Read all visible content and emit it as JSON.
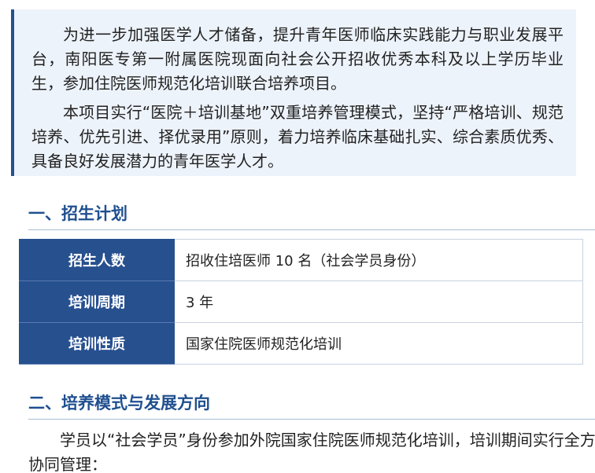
{
  "intro": {
    "paragraphs": [
      "为进一步加强医学人才储备，提升青年医师临床实践能力与职业发展平台，南阳医专第一附属医院现面向社会公开招收优秀本科及以上学历毕业生，参加住院医师规范化培训联合培养项目。",
      "本项目实行“医院＋培训基地”双重培养管理模式，坚持“严格培训、规范培养、优先引进、择优录用”原则，着力培养临床基础扎实、综合素质优秀、具备良好发展潜力的青年医学人才。"
    ]
  },
  "sections": [
    {
      "title": "一、招生计划"
    },
    {
      "title": "二、培养模式与发展方向"
    }
  ],
  "plan_table": {
    "rows": [
      {
        "label": "招生人数",
        "value": "招收住培医师 10 名（社会学员身份）"
      },
      {
        "label": "培训周期",
        "value": "3 年"
      },
      {
        "label": "培训性质",
        "value": "国家住院医师规范化培训"
      }
    ]
  },
  "section2": {
    "paragraph": "学员以“社会学员”身份参加外院国家住院医师规范化培训，培训期间实行全方位协同管理："
  },
  "colors": {
    "accent": "#27508f",
    "heading": "#1f4f8f",
    "intro_bg": "#edf3fb"
  }
}
